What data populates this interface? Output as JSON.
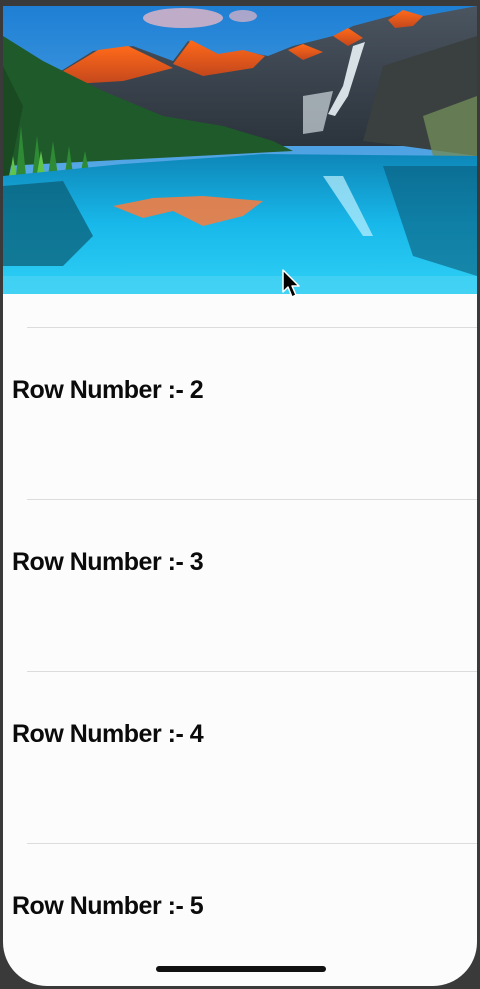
{
  "hero": {
    "image_description": "mountain-lake-landscape"
  },
  "table": {
    "rows": [
      {
        "label": "Row Number :- 2"
      },
      {
        "label": "Row Number :- 3"
      },
      {
        "label": "Row Number :- 4"
      },
      {
        "label": "Row Number :- 5"
      }
    ]
  },
  "colors": {
    "background": "#fcfcfc",
    "separator": "#dcdcdc",
    "text": "#0b0b0b",
    "sky": "#2f8fd8",
    "lake": "#1fb4e6",
    "peak_glow": "#ff5a1f",
    "forest": "#1f5a2a"
  }
}
